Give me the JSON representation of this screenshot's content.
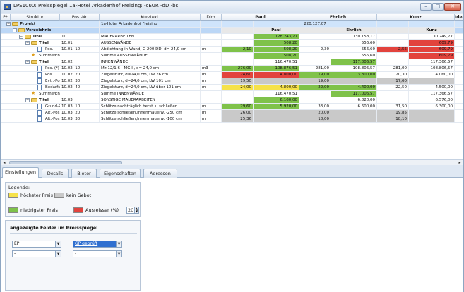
{
  "window": {
    "title": "LPS1000: Preisspiegel 1a-Hotel Arkadenhof Freising: -cEUR -dD -bs",
    "minimize": "–",
    "maximize": "□",
    "close": "✕"
  },
  "colors": {
    "green": "#7fc24a",
    "yellow": "#f6e24a",
    "red": "#e2433d",
    "gray": "#c9c9c9",
    "selection": "#cfe4fb"
  },
  "grid": {
    "headers": {
      "pos": "P*",
      "struktur": "Struktur",
      "posnr": "Pos.-Nr",
      "kurztext": "Kurztext",
      "dim": "Dim",
      "bidder1": "Paul",
      "bidder2": "Ehrlich",
      "bidder3": "Kunz",
      "bidder4": "Idea"
    },
    "rows": [
      {
        "tree": "Projekt",
        "posnr": "",
        "text": "1a-Hotel Arkadenhof Freising",
        "dim": "",
        "a": "",
        "b": "",
        "c": "220.127,07",
        "d": "",
        "e": "",
        "f": ""
      },
      {
        "tree": "Verzeichnis",
        "posnr": "",
        "text": "",
        "dim": "",
        "a": "",
        "b": "Paul",
        "c": "",
        "d": "Ehrlich",
        "e": "",
        "f": "Kunz"
      },
      {
        "tree": "Titel",
        "posnr": "10",
        "text": "MAUERARBEITEN",
        "dim": "",
        "a": "",
        "b": "128.243,77",
        "c": "",
        "d": "130.158,17",
        "e": "",
        "f": "130.249,77"
      },
      {
        "tree": "Titel",
        "posnr": "10.01",
        "text": "AUSSENWÄNDE",
        "dim": "",
        "a": "",
        "b": "508,20",
        "c": "",
        "d": "556,60",
        "e": "",
        "f": "609,79"
      },
      {
        "tree": "Pos.",
        "posnr": "10.01. 10",
        "text": "Abdichtung in Wand, G 200 DD, d= 24,0 cm",
        "dim": "m",
        "a": "2,10",
        "b": "508,20",
        "c": "2,30",
        "d": "556,60",
        "e": "2,55",
        "f": "609,79"
      },
      {
        "tree": "Summe/Ende",
        "posnr": "",
        "text": "Summe AUSSENWÄNDE",
        "dim": "",
        "a": "",
        "b": "508,20",
        "c": "",
        "d": "556,60",
        "e": "",
        "f": "609,79"
      },
      {
        "tree": "Titel",
        "posnr": "10.02",
        "text": "INNENWÄNDE",
        "dim": "",
        "a": "",
        "b": "116.470,51",
        "c": "",
        "d": "117.006,57",
        "e": "",
        "f": "117.366,57"
      },
      {
        "tree": "Pos. (*)",
        "posnr": "10.02. 10",
        "text": "Mz 12/1,6 - MG II, d= 24,0 cm",
        "dim": "m3",
        "a": "276,00",
        "b": "108.876,51",
        "c": "281,00",
        "d": "108.806,57",
        "e": "281,00",
        "f": "108.806,57"
      },
      {
        "tree": "Pos.",
        "posnr": "10.02. 20",
        "text": "Ziegelsturz, d=24,0 cm, LW 76 cm",
        "dim": "m",
        "a": "24,60",
        "b": "4.800,00",
        "c": "19,00",
        "d": "3.800,00",
        "e": "20,30",
        "f": "4.060,00"
      },
      {
        "tree": "Evtl.-Pos.",
        "posnr": "10.02. 30",
        "text": "Ziegelsturz, d=24,0 cm, LW 101 cm",
        "dim": "m",
        "a": "19,50",
        "b": "",
        "c": "19,00",
        "d": "",
        "e": "17,60",
        "f": ""
      },
      {
        "tree": "Bedarfs-P",
        "posnr": "10.02. 40",
        "text": "Ziegelsturz, d=24,0 cm, LW über 101 cm",
        "dim": "m",
        "a": "24,00",
        "b": "4.800,00",
        "c": "22,00",
        "d": "4.400,00",
        "e": "22,50",
        "f": "4.500,00"
      },
      {
        "tree": "Summe/Ende",
        "posnr": "",
        "text": "Summe INNENWÄNDE",
        "dim": "",
        "a": "",
        "b": "116.470,51",
        "c": "",
        "d": "117.006,57",
        "e": "",
        "f": "117.366,57"
      },
      {
        "tree": "Titel",
        "posnr": "10.03",
        "text": "SONSTIGE MAUERARBEITEN",
        "dim": "",
        "a": "",
        "b": "6.160,00",
        "c": "",
        "d": "6.820,00",
        "e": "",
        "f": "6.576,00"
      },
      {
        "tree": "Grund-Pos",
        "posnr": "10.03. 10",
        "text": "Schlitze nachträglich herst. u schließen",
        "dim": "m",
        "a": "29,60",
        "b": "5.920,00",
        "c": "33,00",
        "d": "6.600,00",
        "e": "31,50",
        "f": "6.300,00"
      },
      {
        "tree": "Alt.-Pos. 1",
        "posnr": "10.03. 20",
        "text": "Schlitze schließen,Innenmauerw. -250 cm",
        "dim": "m",
        "a": "26,00",
        "b": "",
        "c": "20,00",
        "d": "",
        "e": "19,85",
        "f": ""
      },
      {
        "tree": "Alt.-Pos. 1",
        "posnr": "10.03. 30",
        "text": "Schlitze schließen,Innenmauerw. -100 cm",
        "dim": "m",
        "a": "25,36",
        "b": "",
        "c": "18,00",
        "d": "",
        "e": "18,10",
        "f": ""
      }
    ]
  },
  "tabs": [
    "Einstellungen",
    "Details",
    "Bieter",
    "Eigenschaften",
    "Adressen"
  ],
  "legend": {
    "title": "Legende:",
    "highest": "höchster Preis",
    "no_offer": "kein Gebot",
    "lowest": "niedrigster Preis",
    "outlier": "Ausreisser (%)",
    "outlier_value": "20"
  },
  "fields": {
    "title": "angezeigte Felder im Preisspiegel",
    "combo1": "EP",
    "combo2": "GP geprüft",
    "combo3": "-",
    "combo4": "-"
  }
}
